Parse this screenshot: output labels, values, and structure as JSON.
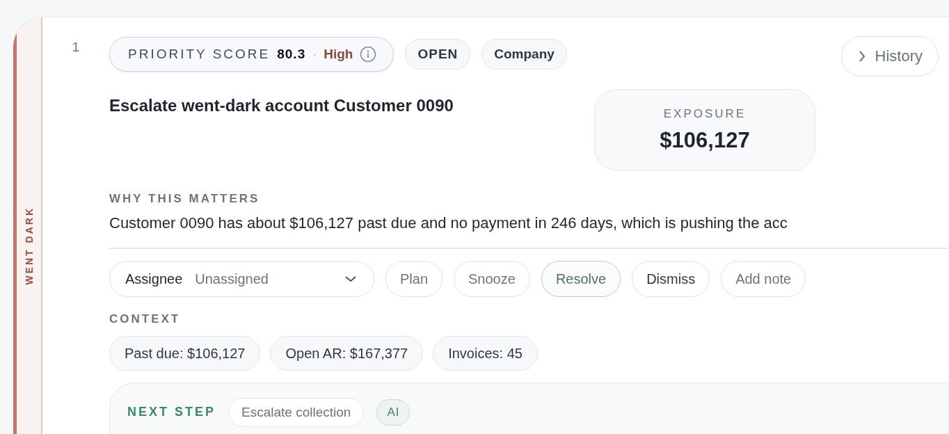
{
  "row_number": "1",
  "band": {
    "label": "WENT DARK"
  },
  "priority": {
    "label": "PRIORITY SCORE",
    "score": "80.3",
    "separator": "·",
    "level_text": "High"
  },
  "badges": [
    "OPEN",
    "Company"
  ],
  "history_button": {
    "label": "History"
  },
  "title": "Escalate went-dark account Customer 0090",
  "exposure": {
    "label": "EXPOSURE",
    "value": "$106,127"
  },
  "why": {
    "heading": "WHY THIS MATTERS",
    "text": "Customer 0090 has about $106,127 past due and no payment in 246 days, which is pushing the acc"
  },
  "assignee": {
    "label": "Assignee",
    "value": "Unassigned"
  },
  "actions": [
    {
      "label": "Plan",
      "kind": "plain"
    },
    {
      "label": "Snooze",
      "kind": "plain"
    },
    {
      "label": "Resolve",
      "kind": "positive"
    },
    {
      "label": "Dismiss",
      "kind": "strong"
    },
    {
      "label": "Add note",
      "kind": "plain"
    }
  ],
  "context": {
    "heading": "CONTEXT",
    "chips": [
      "Past due: $106,127",
      "Open AR: $167,377",
      "Invoices: 45"
    ]
  },
  "next_step": {
    "heading": "NEXT STEP",
    "action": "Escalate collection",
    "tag": "AI"
  }
}
